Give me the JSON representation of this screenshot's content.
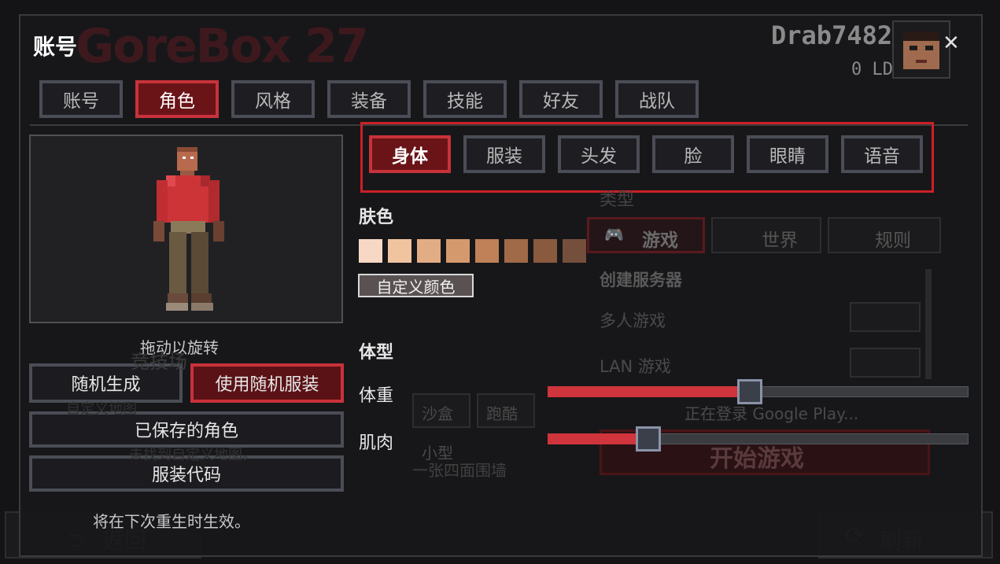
{
  "header": {
    "title": "账号",
    "username": "Drab7482",
    "currency": "0 LD",
    "logo_text": "GoreBox 27"
  },
  "main_tabs": [
    {
      "label": "账号",
      "active": false
    },
    {
      "label": "角色",
      "active": true
    },
    {
      "label": "风格",
      "active": false
    },
    {
      "label": "装备",
      "active": false
    },
    {
      "label": "技能",
      "active": false
    },
    {
      "label": "好友",
      "active": false
    },
    {
      "label": "战队",
      "active": false
    }
  ],
  "sub_tabs": [
    {
      "label": "身体",
      "active": true
    },
    {
      "label": "服装",
      "active": false
    },
    {
      "label": "头发",
      "active": false
    },
    {
      "label": "脸",
      "active": false
    },
    {
      "label": "眼睛",
      "active": false
    },
    {
      "label": "语音",
      "active": false
    }
  ],
  "preview": {
    "hint": "拖动以旋转"
  },
  "left_buttons": {
    "random": "随机生成",
    "random_outfit": "使用随机服装",
    "saved": "已保存的角色",
    "outfit_code": "服装代码"
  },
  "notice": "将在下次重生时生效。",
  "skin": {
    "label": "肤色",
    "colors": [
      "#f6d8c4",
      "#efc49f",
      "#e2ad85",
      "#d49a6e",
      "#c08058",
      "#a06a48",
      "#8a5a3e",
      "#74503c"
    ],
    "custom_label": "自定义颜色"
  },
  "body_type": {
    "label": "体型",
    "weight_label": "体重",
    "weight_value": 0.48,
    "muscle_label": "肌肉",
    "muscle_value": 0.24
  },
  "background_menu": {
    "type_label": "类型",
    "tabs": [
      "游戏",
      "世界",
      "规则"
    ],
    "create_server": "创建服务器",
    "multiplayer": "多人游戏",
    "lan": "LAN 游戏",
    "google_play": "正在登录 Google Play...",
    "start": "开始游戏",
    "sandbox": "沙盒",
    "parkour": "跑酷",
    "small": "小型",
    "walls": "一张四面围墙",
    "arena": "竞技场",
    "custom_map": "自定义地图",
    "no_custom_map": "未找到自定义地图。",
    "back": "返回",
    "refresh": "刷新"
  },
  "colors": {
    "accent": "#c8323a",
    "accent_dark": "#6a1418",
    "highlight_box": "#cc1f26"
  }
}
